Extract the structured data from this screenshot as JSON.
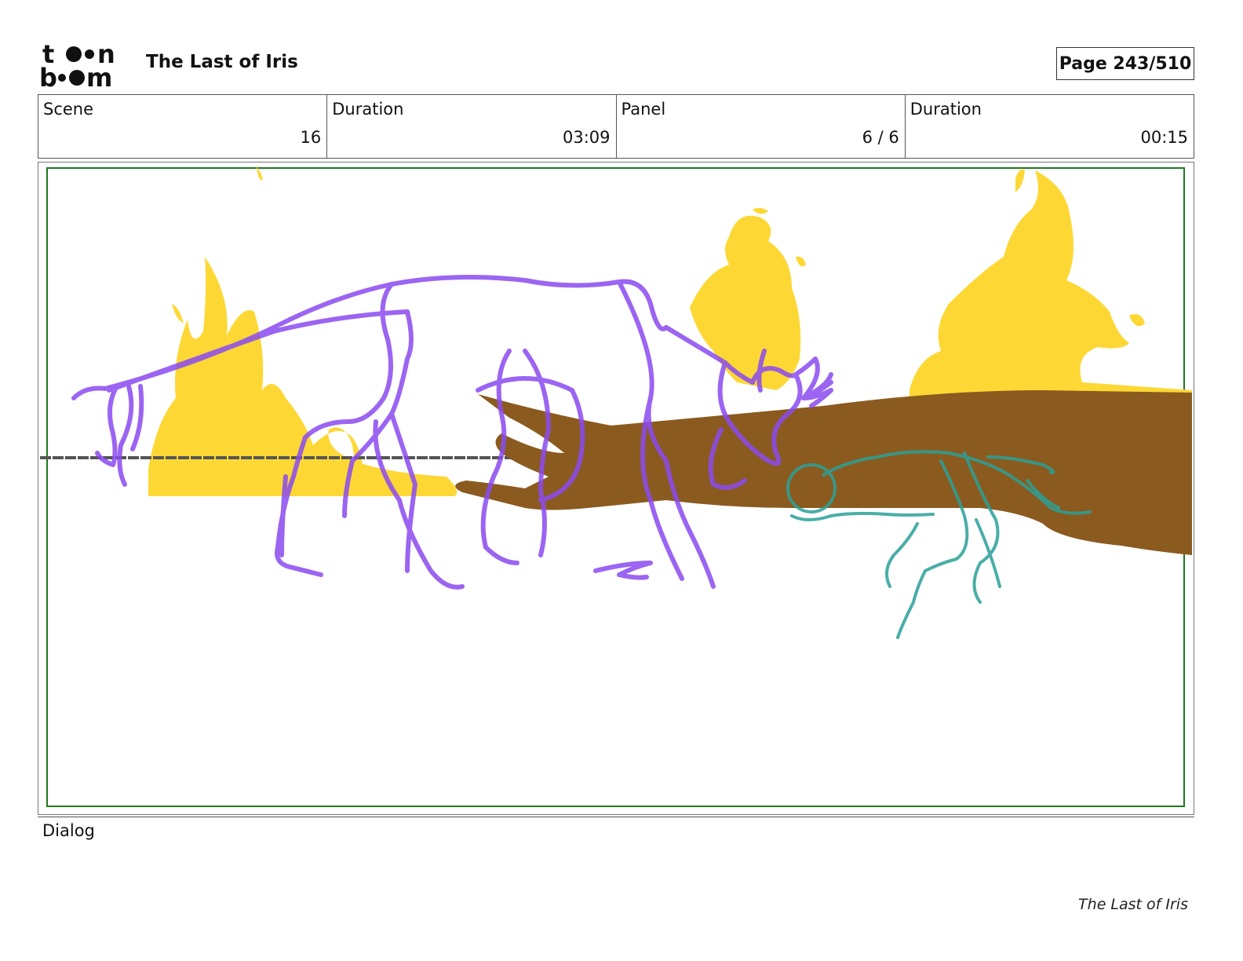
{
  "header": {
    "logo": {
      "brand": "toon boom"
    },
    "title": "The Last of Iris",
    "page": "Page 243/510"
  },
  "info": [
    {
      "label": "Scene",
      "value": "16"
    },
    {
      "label": "Duration",
      "value": "03:09"
    },
    {
      "label": "Panel",
      "value": "6 / 6"
    },
    {
      "label": "Duration",
      "value": "00:15"
    }
  ],
  "panel": {
    "safe_frame_color": "#1e7b1e",
    "colors": {
      "flames": "#fdd835",
      "branch": "#8b5a1f",
      "horse_sketch": "#8a4bf0",
      "small_creature": "#2aa198"
    }
  },
  "dialog": {
    "label": "Dialog"
  },
  "footer": {
    "title": "The Last of Iris"
  }
}
